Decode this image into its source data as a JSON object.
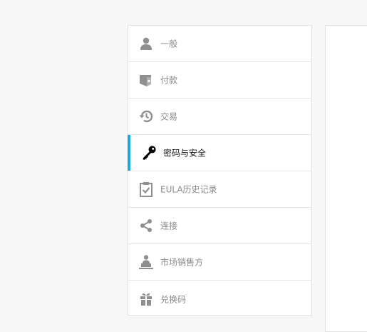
{
  "menu": {
    "items": [
      {
        "label": "一般",
        "icon": "person-icon"
      },
      {
        "label": "付款",
        "icon": "wallet-icon"
      },
      {
        "label": "交易",
        "icon": "history-icon"
      },
      {
        "label": "密码与安全",
        "icon": "key-icon"
      },
      {
        "label": "EULA历史记录",
        "icon": "clipboard-check-icon"
      },
      {
        "label": "连接",
        "icon": "share-icon"
      },
      {
        "label": "市场销售方",
        "icon": "seller-icon"
      },
      {
        "label": "兑换码",
        "icon": "gift-icon"
      }
    ],
    "active_index": 3
  },
  "colors": {
    "accent": "#1ea7e1",
    "icon": "#8f8f8f",
    "icon_active": "#000000",
    "label": "#8a8a8a",
    "label_active": "#1a1a1a"
  }
}
